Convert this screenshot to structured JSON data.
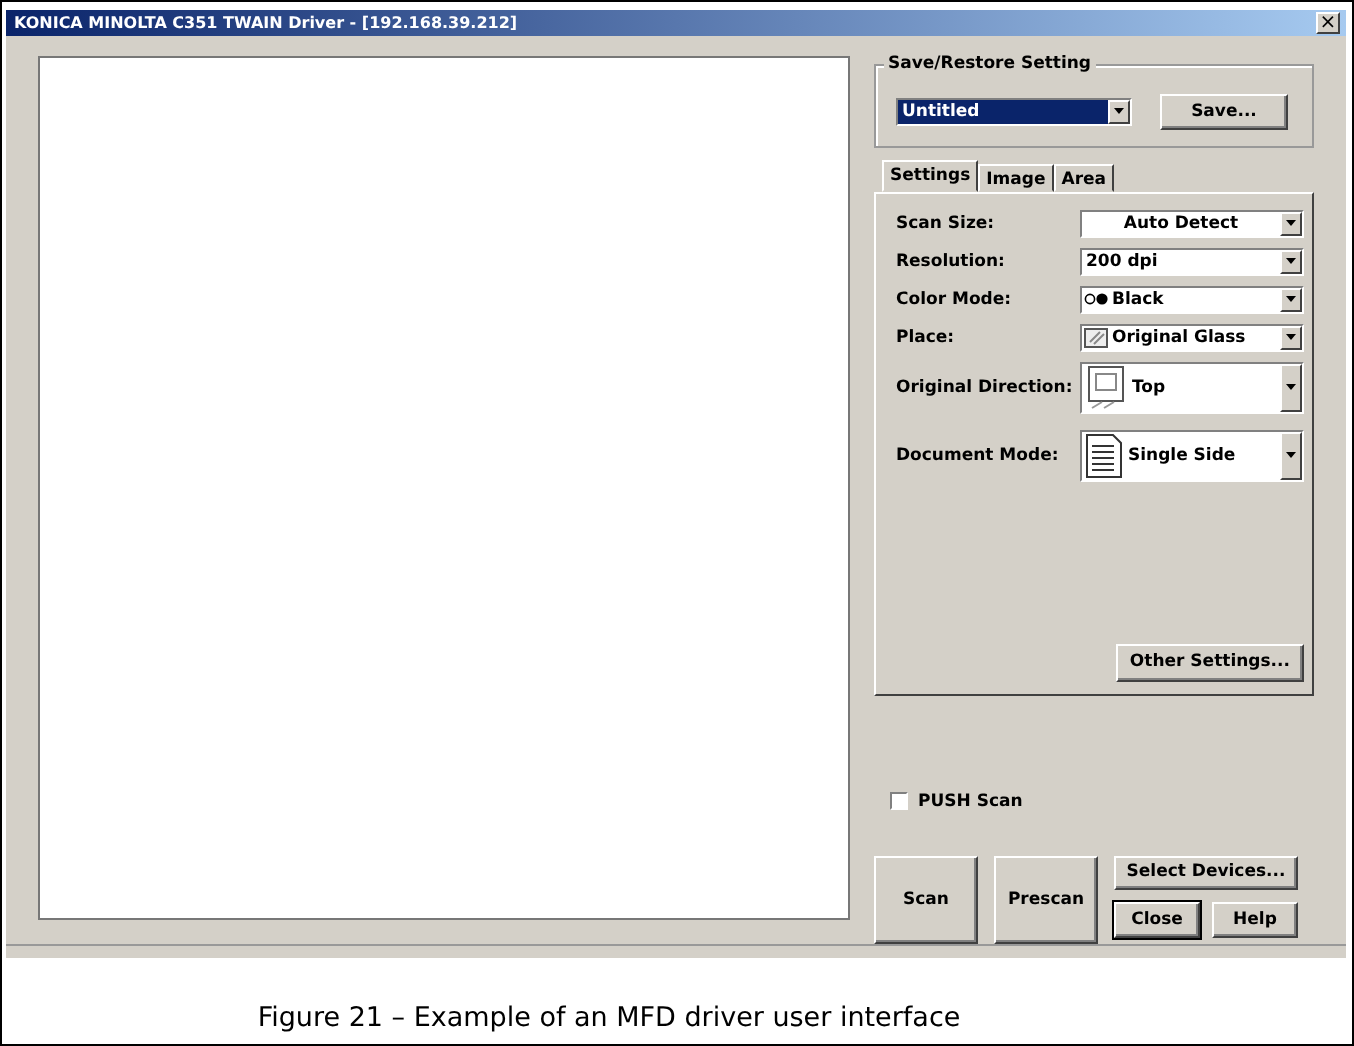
{
  "window": {
    "title": "KONICA MINOLTA C351 TWAIN Driver - [192.168.39.212]",
    "close": "×"
  },
  "save_restore": {
    "legend": "Save/Restore Setting",
    "setting": "Untitled",
    "save_button": "Save..."
  },
  "tabs": [
    {
      "label": "Settings",
      "selected": true
    },
    {
      "label": "Image",
      "selected": false
    },
    {
      "label": "Area",
      "selected": false
    }
  ],
  "settings": [
    {
      "label": "Scan Size:",
      "value": "Auto Detect",
      "kind": "centered"
    },
    {
      "label": "Resolution:",
      "value": "200 dpi",
      "kind": "plain"
    },
    {
      "label": "Color Mode:",
      "value": "Black",
      "kind": "color"
    },
    {
      "label": "Place:",
      "value": "Original Glass",
      "kind": "glass"
    },
    {
      "label": "Original Direction:",
      "value": "Top",
      "kind": "direction"
    },
    {
      "label": "Document Mode:",
      "value": "Single Side",
      "kind": "document"
    }
  ],
  "other_settings_button": "Other Settings...",
  "push_scan": {
    "label": "PUSH Scan",
    "checked": false
  },
  "buttons": {
    "scan": "Scan",
    "prescan": "Prescan",
    "select_devices": "Select Devices...",
    "close": "Close",
    "help": "Help"
  },
  "caption": "Figure 21 – Example of an MFD driver user interface"
}
